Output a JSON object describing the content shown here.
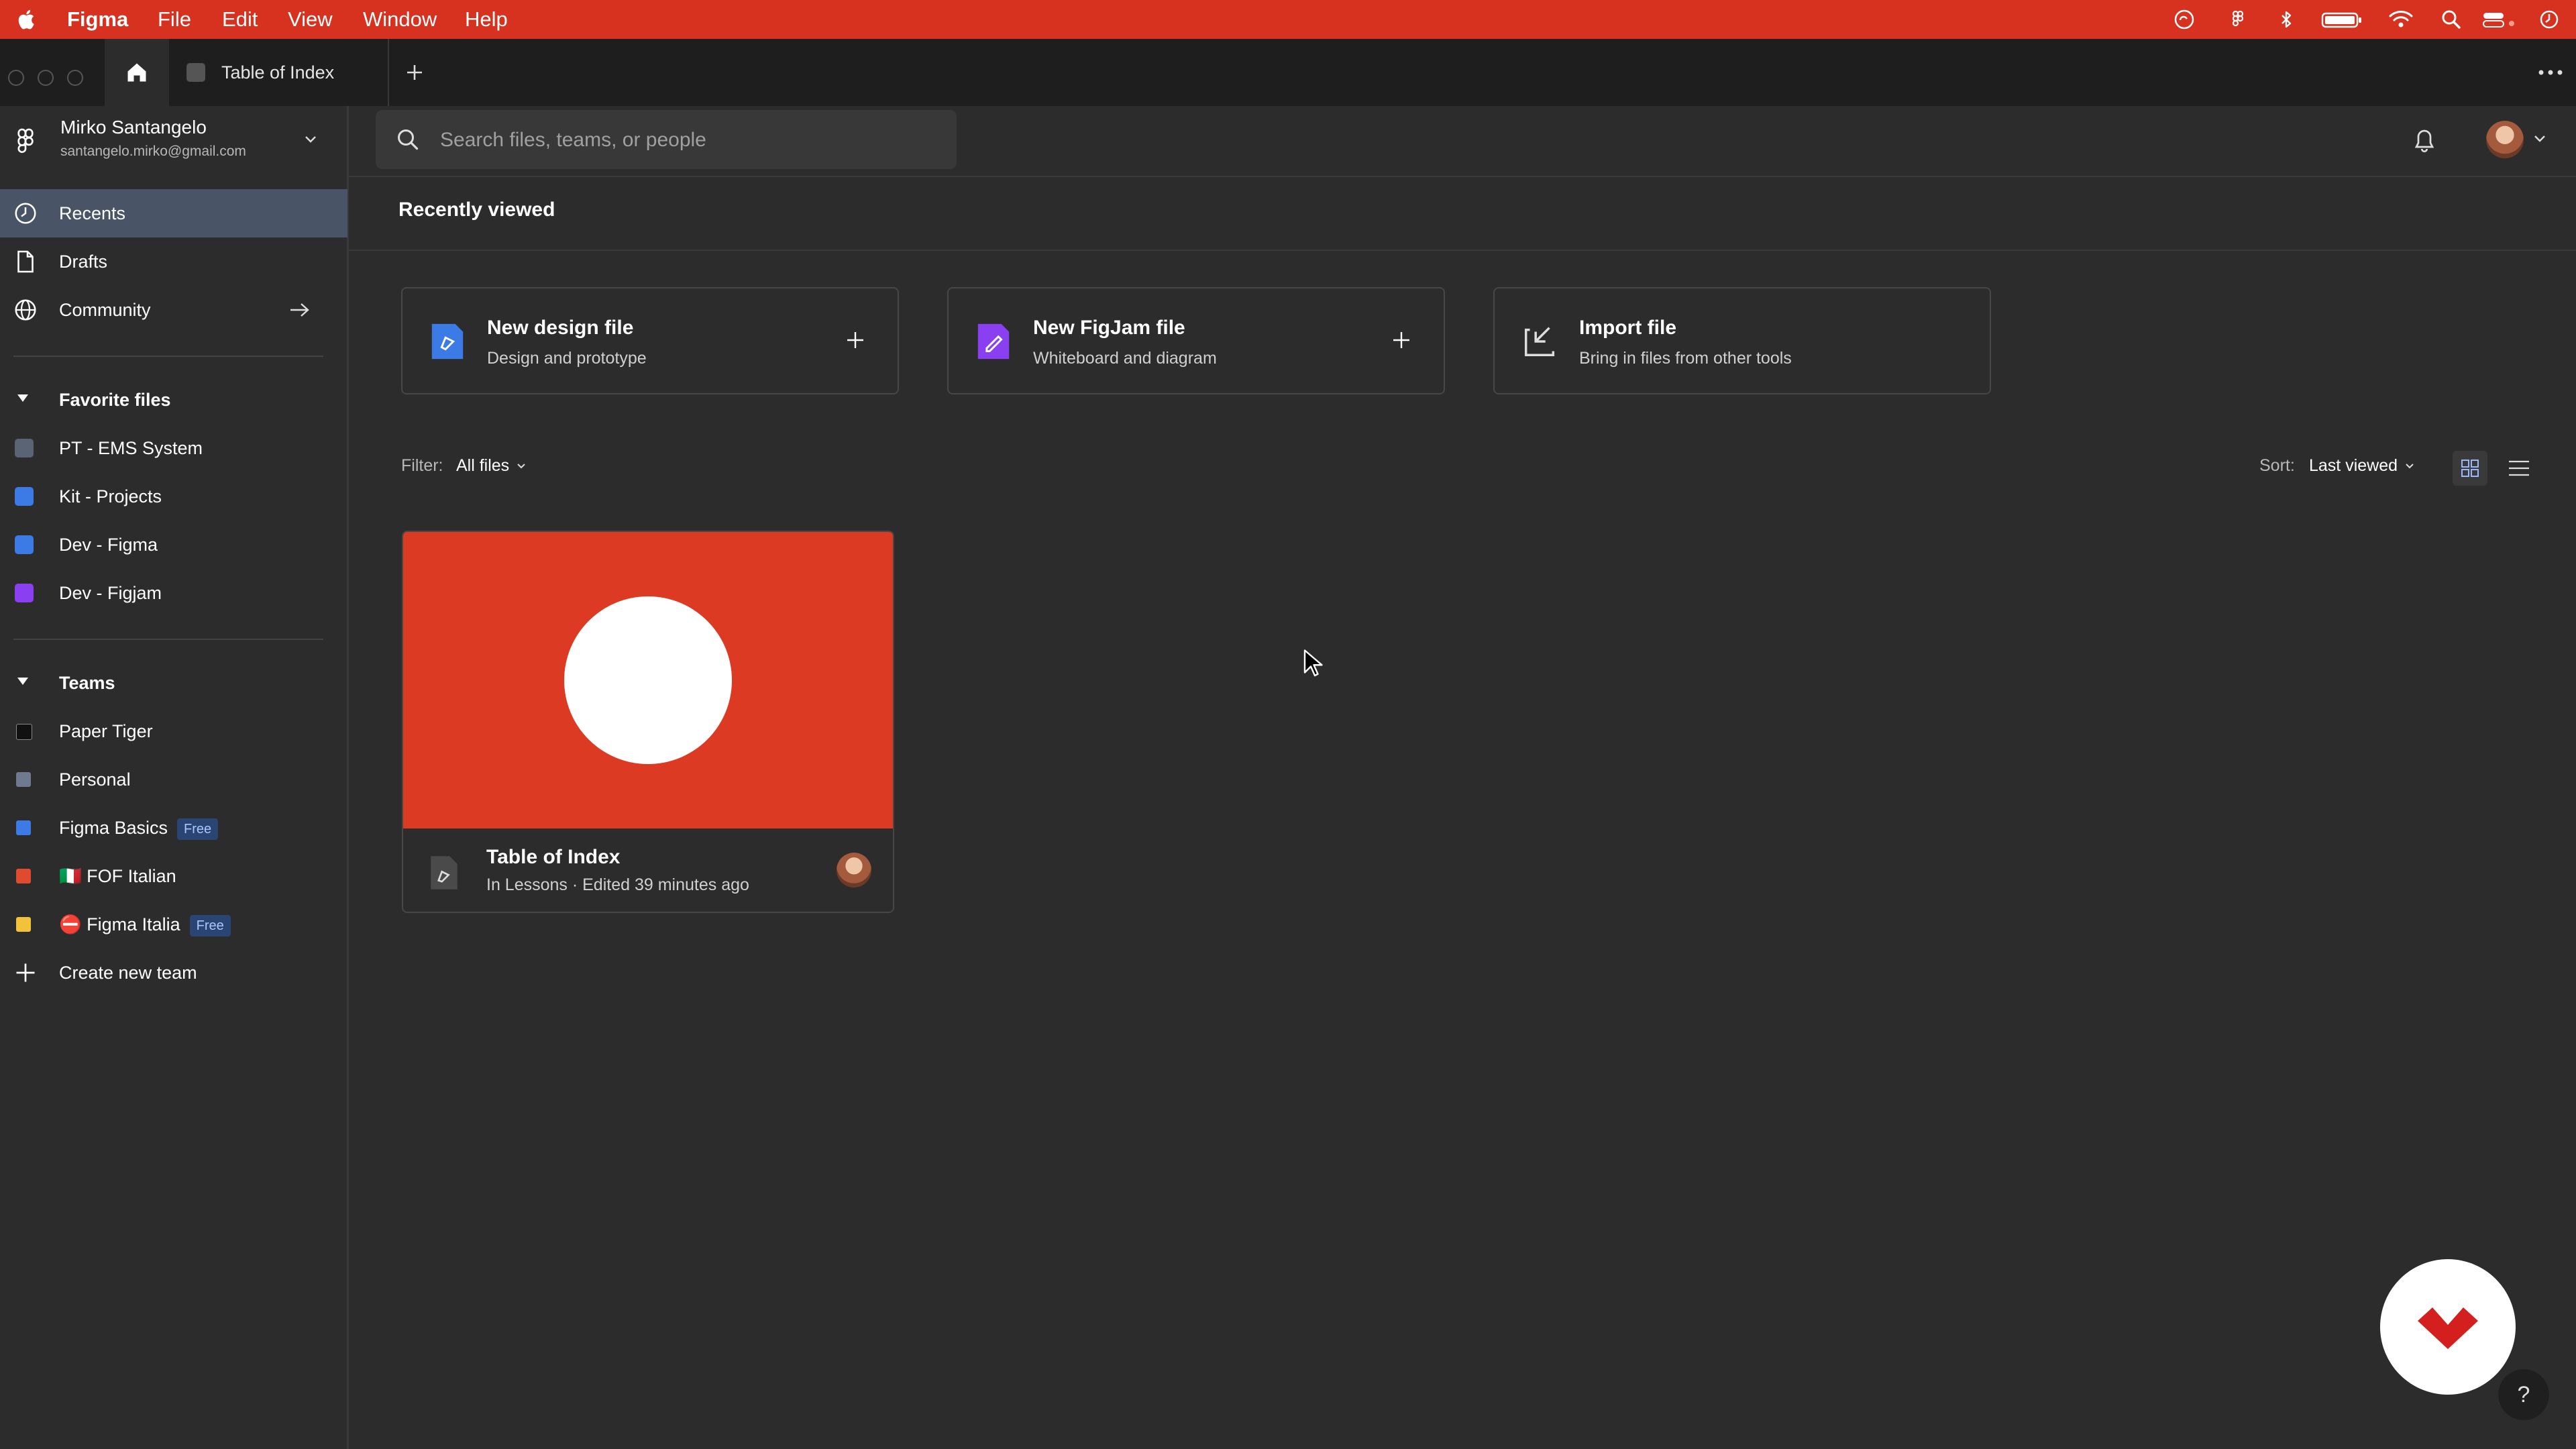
{
  "menubar": {
    "app": "Figma",
    "items": [
      "File",
      "Edit",
      "View",
      "Window",
      "Help"
    ]
  },
  "tabs": {
    "file_tab": "Table of Index"
  },
  "account": {
    "name": "Mirko Santangelo",
    "email": "santangelo.mirko@gmail.com"
  },
  "search": {
    "placeholder": "Search files, teams, or people"
  },
  "nav": {
    "recents": "Recents",
    "drafts": "Drafts",
    "community": "Community"
  },
  "favorites": {
    "header": "Favorite files",
    "items": [
      "PT - EMS System",
      "Kit - Projects",
      "Dev - Figma",
      "Dev - Figjam"
    ]
  },
  "teams": {
    "header": "Teams",
    "items": [
      {
        "label": "Paper Tiger",
        "badge": ""
      },
      {
        "label": "Personal",
        "badge": ""
      },
      {
        "label": "Figma Basics",
        "badge": "Free"
      },
      {
        "label": "🇮🇹 FOF Italian",
        "badge": ""
      },
      {
        "label": "⛔ Figma Italia",
        "badge": "Free"
      }
    ],
    "create": "Create new team"
  },
  "main": {
    "title": "Recently viewed",
    "actions": [
      {
        "title": "New design file",
        "subtitle": "Design and prototype"
      },
      {
        "title": "New FigJam file",
        "subtitle": "Whiteboard and diagram"
      },
      {
        "title": "Import file",
        "subtitle": "Bring in files from other tools"
      }
    ],
    "filter_label": "Filter:",
    "filter_value": "All files",
    "sort_label": "Sort:",
    "sort_value": "Last viewed",
    "file": {
      "title": "Table of Index",
      "meta": "In Lessons · Edited 39 minutes ago"
    }
  },
  "help": "?",
  "colors": {
    "menubar": "#d6321f",
    "thumbnail": "#dd3a24",
    "sidebar_active": "#4a5467",
    "figma_blue": "#3c7ae6",
    "figjam_purple": "#8a3ff0"
  }
}
